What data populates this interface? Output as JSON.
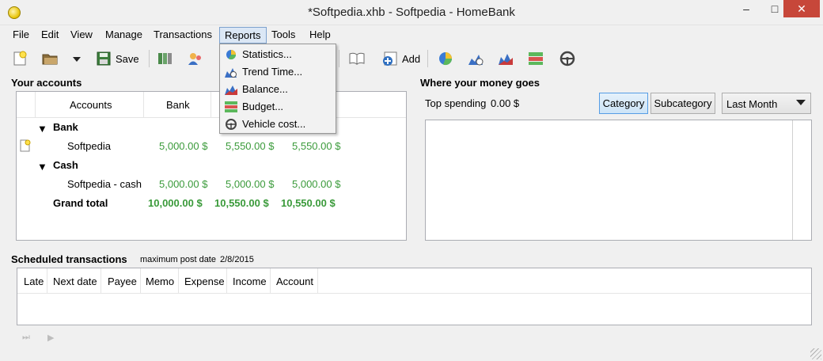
{
  "window": {
    "title": "*Softpedia.xhb - Softpedia - HomeBank",
    "min": "–",
    "max": "□",
    "close": "✕"
  },
  "menu": [
    "File",
    "Edit",
    "View",
    "Manage",
    "Transactions",
    "Reports",
    "Tools",
    "Help"
  ],
  "toolbar": {
    "save": "Save",
    "add": "Add"
  },
  "reports_menu": [
    "Statistics...",
    "Trend Time...",
    "Balance...",
    "Budget...",
    "Vehicle cost..."
  ],
  "accounts": {
    "title": "Your accounts",
    "headers": [
      "Accounts",
      "Bank"
    ],
    "groups": [
      {
        "name": "Bank",
        "rows": [
          {
            "name": "Softpedia",
            "values": [
              "5,000.00 $",
              "5,550.00 $",
              "5,550.00 $"
            ]
          }
        ]
      },
      {
        "name": "Cash",
        "rows": [
          {
            "name": "Softpedia - cash",
            "values": [
              "5,000.00 $",
              "5,000.00 $",
              "5,000.00 $"
            ]
          }
        ]
      }
    ],
    "total": {
      "label": "Grand total",
      "values": [
        "10,000.00 $",
        "10,550.00 $",
        "10,550.00 $"
      ]
    }
  },
  "where": {
    "title": "Where your money goes",
    "top_spending_label": "Top spending",
    "top_spending_value": "0.00 $",
    "btn_category": "Category",
    "btn_subcategory": "Subcategory",
    "period": "Last Month"
  },
  "scheduled": {
    "title": "Scheduled transactions",
    "post_label": "maximum post date",
    "post_date": "2/8/2015",
    "headers": [
      "Late",
      "Next date",
      "Payee",
      "Memo",
      "Expense",
      "Income",
      "Account"
    ]
  },
  "colors": {
    "positive_amount": "#3a9a3a",
    "menu_highlight": "#dbe7f5"
  }
}
